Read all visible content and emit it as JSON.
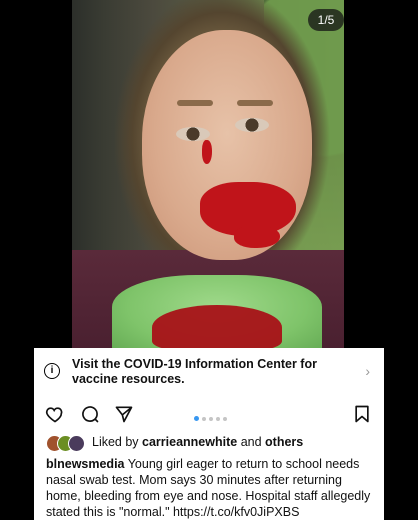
{
  "media": {
    "counter": "1/5",
    "dots_total": 5,
    "dots_active": 1
  },
  "info_banner": {
    "text": "Visit the COVID-19 Information Center for vaccine resources.",
    "info_icon_glyph": "i",
    "chevron_glyph": "›"
  },
  "likes": {
    "prefix": "Liked by ",
    "user": "carrieannewhite",
    "middle": " and ",
    "others": "others"
  },
  "caption": {
    "username": "blnewsmedia",
    "text": " Young girl eager to return to school needs nasal swab test. Mom says 30 minutes after returning home, bleeding from eye and nose. Hospital staff allegedly stated this is \"normal.\" https://t.co/kfv0JiPXBS"
  },
  "colors": {
    "accent_dot": "#3897f0",
    "text": "#111111",
    "background": "#000000",
    "panel": "#ffffff"
  },
  "icons": [
    "info-icon",
    "heart-icon",
    "comment-icon",
    "share-icon",
    "bookmark-icon",
    "chevron-right-icon"
  ]
}
